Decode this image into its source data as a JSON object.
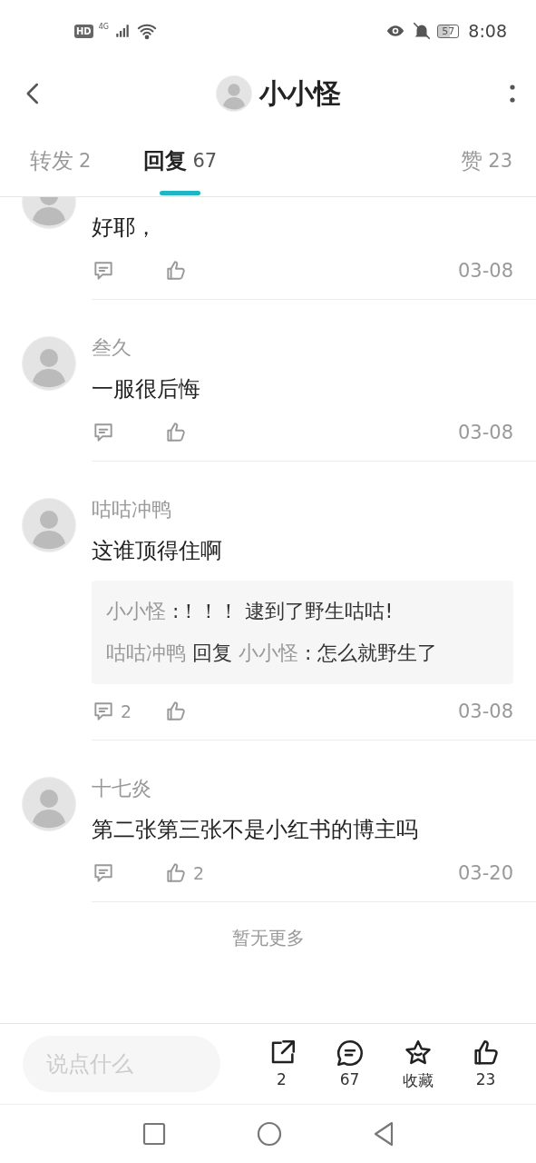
{
  "status_bar": {
    "network_badge": "HD",
    "network_type": "4G",
    "battery": "57",
    "time": "8:08"
  },
  "header": {
    "title": "小小怪"
  },
  "tabs": [
    {
      "label": "转发",
      "count": "2",
      "selected": false
    },
    {
      "label": "回复",
      "count": "67",
      "selected": true
    },
    {
      "label": "赞",
      "count": "23",
      "selected": false
    }
  ],
  "comments": [
    {
      "text": "好耶，",
      "date": "03-08"
    },
    {
      "author": "叁久",
      "text": "一服很后悔",
      "date": "03-08"
    },
    {
      "author": "咕咕冲鸭",
      "text": "这谁顶得住啊",
      "replies": [
        [
          {
            "kind": "name",
            "text": "小小怪"
          },
          {
            "kind": "text",
            "text": " :！！！ 逮到了野生咕咕!"
          }
        ],
        [
          {
            "kind": "name",
            "text": "咕咕冲鸭"
          },
          {
            "kind": "text",
            "text": " 回复 "
          },
          {
            "kind": "name",
            "text": "小小怪"
          },
          {
            "kind": "text",
            "text": " : 怎么就野生了"
          }
        ]
      ],
      "reply_count": "2",
      "date": "03-08"
    },
    {
      "author": "十七炎",
      "text": "第二张第三张不是小红书的博主吗",
      "like_count": "2",
      "date": "03-20"
    }
  ],
  "end_note": "暂无更多",
  "composer": {
    "placeholder": "说点什么"
  },
  "actions": [
    {
      "kind": "share",
      "label": "2"
    },
    {
      "kind": "comment",
      "label": "67"
    },
    {
      "kind": "favorite",
      "label": "收藏"
    },
    {
      "kind": "like",
      "label": "23"
    }
  ]
}
